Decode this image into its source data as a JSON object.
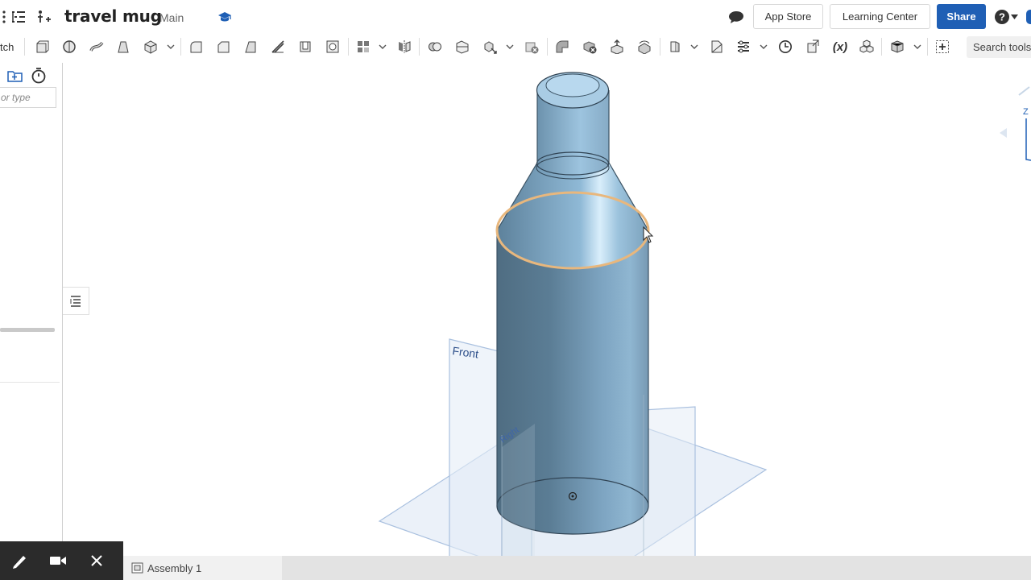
{
  "header": {
    "document_title": "travel mug",
    "branch": "Main",
    "app_store_label": "App Store",
    "learning_center_label": "Learning Center",
    "share_label": "Share"
  },
  "toolbar": {
    "sketch_label": "tch",
    "search_tools_label": "Search tools",
    "formula_label": "(x)"
  },
  "left_panel": {
    "filter_placeholder": "or type"
  },
  "viewport": {
    "plane_front_label": "Front",
    "plane_right_label": "Right",
    "view_cube_label": "Z"
  },
  "bottom": {
    "tab_label": "Assembly 1"
  },
  "colors": {
    "share_blue": "#1f5fb5",
    "model_body": "#6e93ad",
    "selection_edge": "#e8b77d",
    "plane_blue": "#b9cde6"
  }
}
